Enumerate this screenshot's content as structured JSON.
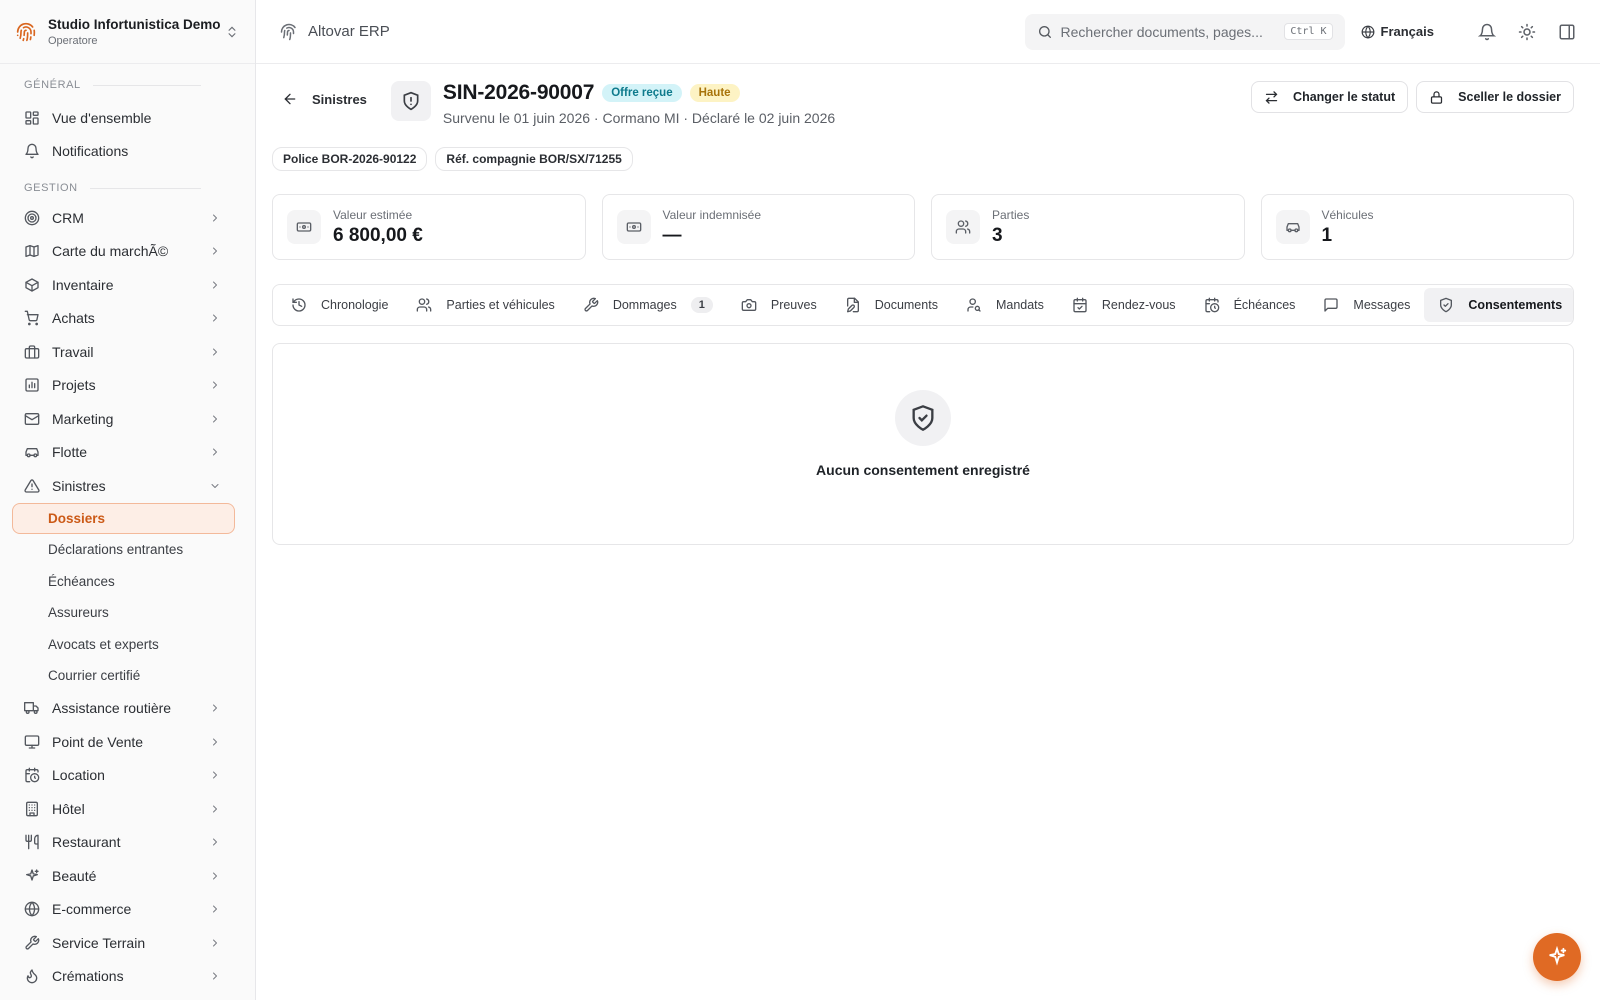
{
  "org": {
    "name": "Studio Infortunistica Demo",
    "role": "Operatore"
  },
  "sidebar": {
    "general_label": "GÉNÉRAL",
    "general": [
      {
        "label": "Vue d'ensemble",
        "icon": "dashboard-icon"
      },
      {
        "label": "Notifications",
        "icon": "bell-icon"
      }
    ],
    "gestion_label": "GESTION",
    "gestion": [
      {
        "label": "CRM",
        "icon": "target-icon"
      },
      {
        "label": "Carte du marchÃ©",
        "icon": "map-icon"
      },
      {
        "label": "Inventaire",
        "icon": "box-icon"
      },
      {
        "label": "Achats",
        "icon": "cart-icon"
      },
      {
        "label": "Travail",
        "icon": "briefcase-icon"
      },
      {
        "label": "Projets",
        "icon": "chart-icon"
      },
      {
        "label": "Marketing",
        "icon": "mail-icon"
      },
      {
        "label": "Flotte",
        "icon": "car-icon"
      },
      {
        "label": "Sinistres",
        "icon": "warning-icon"
      }
    ],
    "sinistres_sub": [
      {
        "label": "Dossiers",
        "active": true
      },
      {
        "label": "Déclarations entrantes"
      },
      {
        "label": "Échéances"
      },
      {
        "label": "Assureurs"
      },
      {
        "label": "Avocats et experts"
      },
      {
        "label": "Courrier certifié"
      }
    ],
    "more": [
      {
        "label": "Assistance routière",
        "icon": "truck-icon"
      },
      {
        "label": "Point de Vente",
        "icon": "monitor-icon"
      },
      {
        "label": "Location",
        "icon": "calendar-clock-icon"
      },
      {
        "label": "Hôtel",
        "icon": "building-icon"
      },
      {
        "label": "Restaurant",
        "icon": "utensils-icon"
      },
      {
        "label": "Beauté",
        "icon": "sparkles-icon"
      },
      {
        "label": "E-commerce",
        "icon": "globe-icon"
      },
      {
        "label": "Service Terrain",
        "icon": "wrench-icon"
      },
      {
        "label": "Crémations",
        "icon": "flame-icon"
      }
    ]
  },
  "topbar": {
    "app_name": "Altovar ERP",
    "search_placeholder": "Rechercher documents, pages...",
    "shortcut": "Ctrl K",
    "language": "Français"
  },
  "case": {
    "back_label": "Sinistres",
    "title": "SIN-2026-90007",
    "status": "Offre reçue",
    "priority": "Haute",
    "subtitle": "Survenu le 01 juin 2026 · Cormano MI · Déclaré le 02 juin 2026",
    "actions": {
      "change_status": "Changer le statut",
      "seal": "Sceller le dossier"
    },
    "chips": [
      "Police BOR-2026-90122",
      "Réf. compagnie BOR/SX/71255"
    ]
  },
  "stats": [
    {
      "label": "Valeur estimée",
      "value": "6 800,00 €",
      "icon": "money-icon"
    },
    {
      "label": "Valeur indemnisée",
      "value": "—",
      "icon": "money-icon"
    },
    {
      "label": "Parties",
      "value": "3",
      "icon": "users-icon"
    },
    {
      "label": "Véhicules",
      "value": "1",
      "icon": "car-icon"
    }
  ],
  "tabs": [
    {
      "label": "Chronologie",
      "icon": "history-icon"
    },
    {
      "label": "Parties et véhicules",
      "icon": "users-icon"
    },
    {
      "label": "Dommages",
      "icon": "wrench-icon",
      "count": "1"
    },
    {
      "label": "Preuves",
      "icon": "camera-icon"
    },
    {
      "label": "Documents",
      "icon": "file-edit-icon"
    },
    {
      "label": "Mandats",
      "icon": "user-key-icon"
    },
    {
      "label": "Rendez-vous",
      "icon": "calendar-check-icon"
    },
    {
      "label": "Échéances",
      "icon": "calendar-clock-icon"
    },
    {
      "label": "Messages",
      "icon": "message-icon"
    },
    {
      "label": "Consentements",
      "icon": "shield-check-icon",
      "active": true
    },
    {
      "label": "",
      "icon": "mail-icon"
    }
  ],
  "empty_state": {
    "message": "Aucun consentement enregistré"
  }
}
